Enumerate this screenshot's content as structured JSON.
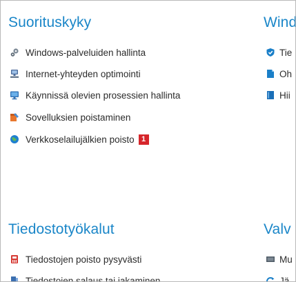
{
  "left": {
    "title": "Suorituskyky",
    "items": [
      {
        "label": "Windows-palveluiden hallinta",
        "icon": "gears-icon"
      },
      {
        "label": "Internet-yhteyden optimointi",
        "icon": "network-computer-icon"
      },
      {
        "label": "Käynnissä olevien prosessien hallinta",
        "icon": "monitor-icon"
      },
      {
        "label": "Sovelluksien poistaminen",
        "icon": "uninstall-box-icon"
      },
      {
        "label": "Verkkoselailujälkien poisto",
        "icon": "globe-icon",
        "badge": "1"
      }
    ]
  },
  "left_bottom": {
    "title": "Tiedostotyökalut",
    "items": [
      {
        "label": "Tiedostojen poisto pysyvästi",
        "icon": "shredder-icon"
      },
      {
        "label": "Tiedostojen salaus tai jakaminen",
        "icon": "file-split-icon"
      }
    ]
  },
  "right": {
    "title": "Wind",
    "items": [
      {
        "label": "Tie",
        "icon": "shield-icon"
      },
      {
        "label": "Oh",
        "icon": "document-icon"
      },
      {
        "label": "Hii",
        "icon": "book-icon"
      }
    ]
  },
  "right_bottom": {
    "title": "Valv",
    "items": [
      {
        "label": "Mu",
        "icon": "memory-chip-icon"
      },
      {
        "label": "Jä",
        "icon": "refresh-icon"
      }
    ]
  },
  "colors": {
    "title": "#1a86c8",
    "badge": "#d6262b",
    "text": "#2b2b2b"
  }
}
